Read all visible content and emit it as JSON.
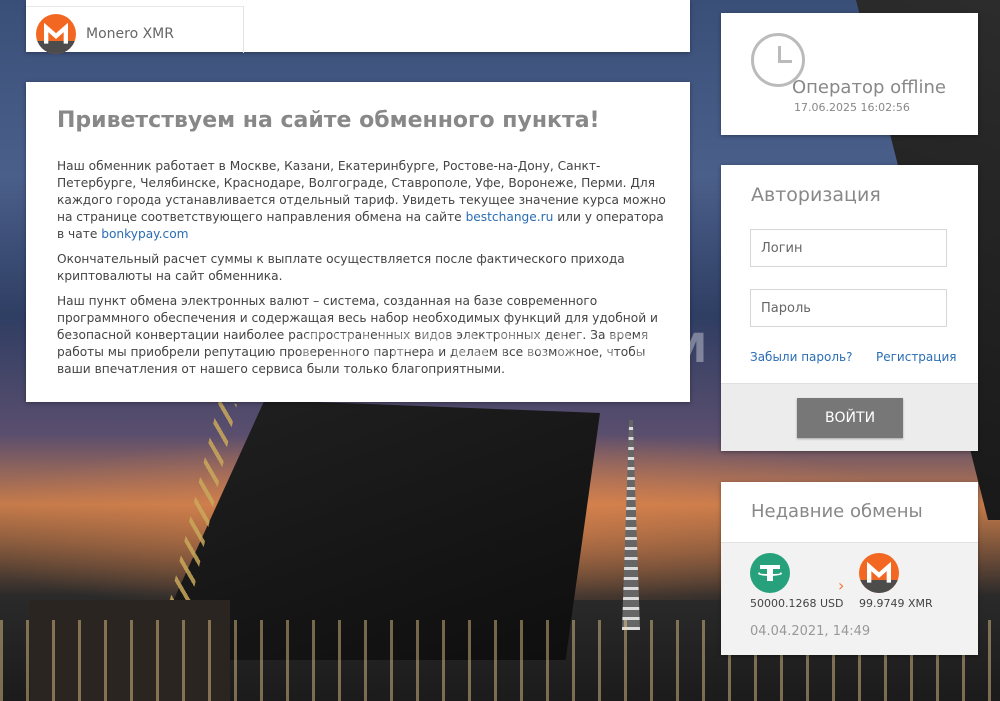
{
  "currency_panel": {
    "name": "Monero XMR"
  },
  "welcome": {
    "title": "Приветствуем на сайте обменного пункта!",
    "p1_text": "Наш обменник работает в Москве, Казани, Екатеринбурге, Ростове-на-Дону, Санкт-Петербурге, Челябинске, Краснодаре, Волгограде, Ставрополе, Уфе, Воронеже, Перми. Для каждого города устанавливается отдельный тариф. Увидеть текущее значение курса можно на странице соответствующего  направления обмена на сайте ",
    "link1": "bestchange.ru",
    "p1_mid": "  или у оператора в чате ",
    "link2": "bonkypay.com",
    "p2": "Окончательный расчет суммы к выплате осуществляется после фактического прихода криптовалюты на сайт обменника.",
    "p3": "Наш пункт обмена электронных валют – система, созданная на базе современного программного обеспечения и содержащая весь набор необходимых функций для удобной и безопасной конвертации наиболее распространенных видов электронных денег. За время работы мы приобрели репутацию проверенного партнера и делаем все возможное, чтобы ваши впечатления от нашего сервиса были только благоприятными."
  },
  "watermark": "CRYPTWERK.COM",
  "operator": {
    "status": "Оператор offline",
    "datetime": "17.06.2025 16:02:56",
    "icon": "clock-icon"
  },
  "auth": {
    "title": "Авторизация",
    "login_placeholder": "Логин",
    "password_placeholder": "Пароль",
    "forgot": "Забыли пароль?",
    "register": "Регистрация",
    "submit": "ВОЙТИ"
  },
  "recent": {
    "title": "Недавние обмены",
    "from_amount": "50000.1268 USD",
    "to_amount": "99.9749 XMR",
    "arrow": "›",
    "date": "04.04.2021, 14:49"
  },
  "colors": {
    "xmr": "#f26822",
    "usdt": "#26a17b",
    "link": "#2a6db5",
    "button": "#777777"
  }
}
